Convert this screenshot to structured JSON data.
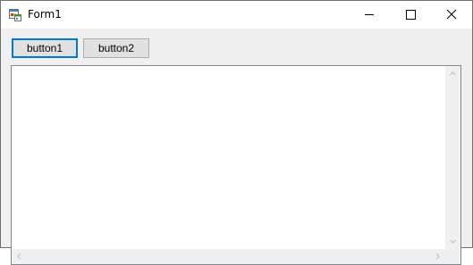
{
  "window": {
    "title": "Form1",
    "app_icon": "form-app-icon",
    "controls": {
      "minimize_icon": "minimize-icon",
      "maximize_icon": "maximize-icon",
      "close_icon": "close-icon"
    }
  },
  "buttons": {
    "button1_label": "button1",
    "button2_label": "button2"
  },
  "textbox": {
    "value": "",
    "scroll_icons": [
      "chevron-up-icon",
      "chevron-down-icon",
      "chevron-left-icon",
      "chevron-right-icon"
    ]
  },
  "colors": {
    "focus_accent": "#0078d7",
    "button_face": "#e1e1e1",
    "window_bg": "#f0f0f0"
  }
}
